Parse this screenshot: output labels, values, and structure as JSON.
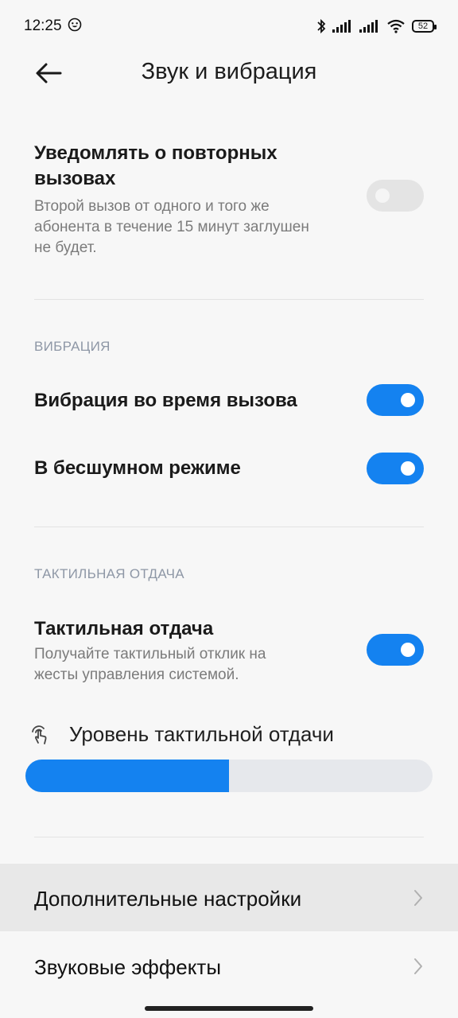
{
  "status": {
    "time": "12:25",
    "battery": "52",
    "icons": [
      "emoji-notification-icon",
      "bluetooth-icon",
      "signal-icon",
      "signal-icon",
      "wifi-icon",
      "battery-icon"
    ]
  },
  "header": {
    "title": "Звук и вибрация",
    "back_icon": "arrow-left-icon"
  },
  "repeat_calls": {
    "title_line1": "Уведомлять о повторных",
    "title_line2": "вызовах",
    "desc_line1": "Второй вызов от одного и того же",
    "desc_line2": "абонента в течение 15 минут заглушен",
    "desc_line3": "не будет.",
    "enabled": false
  },
  "vibration_section": {
    "header": "ВИБРАЦИЯ",
    "during_call": {
      "label": "Вибрация во время вызова",
      "enabled": true
    },
    "silent_mode": {
      "label": "В бесшумном режиме",
      "enabled": true
    }
  },
  "haptic_section": {
    "header": "ТАКТИЛЬНАЯ ОТДАЧА",
    "haptic": {
      "title": "Тактильная отдача",
      "desc_line1": "Получайте тактильный отклик на",
      "desc_line2": "жесты управления системой.",
      "enabled": true
    },
    "level": {
      "label": "Уровень тактильной отдачи",
      "icon": "touch-hand-icon",
      "value_fraction": 0.5
    }
  },
  "links": {
    "additional": "Дополнительные настройки",
    "sound_effects": "Звуковые эффекты",
    "chevron_icon": "chevron-right-icon"
  },
  "colors": {
    "accent": "#1482f0",
    "background": "#f7f7f7",
    "section_header": "#8e97a6"
  }
}
